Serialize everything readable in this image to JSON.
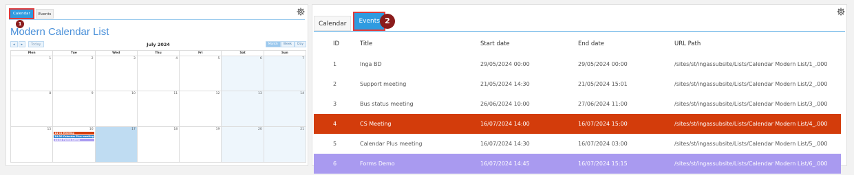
{
  "left": {
    "tabs": [
      {
        "label": "Calendar",
        "active": true
      },
      {
        "label": "Events",
        "active": false
      }
    ],
    "callout": "1",
    "title": "Modern Calendar List",
    "nav": {
      "prev": "◂",
      "next": "▸",
      "today": "Today"
    },
    "month_label": "July 2024",
    "views": [
      {
        "label": "Month",
        "active": true
      },
      {
        "label": "Week",
        "active": false
      },
      {
        "label": "Day",
        "active": false
      }
    ],
    "weekdays": [
      "Mon",
      "Tue",
      "Wed",
      "Thu",
      "Fri",
      "Sat",
      "Sun"
    ],
    "weeks": [
      {
        "days": [
          {
            "num": "1"
          },
          {
            "num": "2"
          },
          {
            "num": "3"
          },
          {
            "num": "4"
          },
          {
            "num": "5"
          },
          {
            "num": "6",
            "weekend": true
          },
          {
            "num": "7",
            "weekend": true
          }
        ]
      },
      {
        "days": [
          {
            "num": "8"
          },
          {
            "num": "9"
          },
          {
            "num": "10"
          },
          {
            "num": "11"
          },
          {
            "num": "12"
          },
          {
            "num": "13",
            "weekend": true
          },
          {
            "num": "14",
            "weekend": true
          }
        ]
      },
      {
        "days": [
          {
            "num": "15"
          },
          {
            "num": "16",
            "events": [
              {
                "text": "14 CS Meeting",
                "color": "#d33c0b"
              },
              {
                "text": "14:30 Calendar Plus meeting",
                "color": "#2f88d0"
              },
              {
                "text": "14:45 Forms Demo",
                "color": "#a99af0"
              }
            ]
          },
          {
            "num": "17",
            "today": true
          },
          {
            "num": "18"
          },
          {
            "num": "19"
          },
          {
            "num": "20",
            "weekend": true
          },
          {
            "num": "21",
            "weekend": true
          }
        ]
      }
    ]
  },
  "right": {
    "tabs": [
      {
        "label": "Calendar",
        "active": false
      },
      {
        "label": "Events",
        "active": true
      }
    ],
    "callout": "2",
    "columns": [
      "ID",
      "Title",
      "Start date",
      "End date",
      "URL Path"
    ],
    "rows": [
      {
        "id": "1",
        "title": "Inga BD",
        "start": "29/05/2024 00:00",
        "end": "29/05/2024 00:00",
        "url": "/sites/st/ingassubsite/Lists/Calendar Modern List/1_.000",
        "bg": ""
      },
      {
        "id": "2",
        "title": "Support meeting",
        "start": "21/05/2024 14:30",
        "end": "21/05/2024 15:01",
        "url": "/sites/st/ingassubsite/Lists/Calendar Modern List/2_.000",
        "bg": ""
      },
      {
        "id": "3",
        "title": "Bus status meeting",
        "start": "26/06/2024 10:00",
        "end": "27/06/2024 11:00",
        "url": "/sites/st/ingassubsite/Lists/Calendar Modern List/3_.000",
        "bg": ""
      },
      {
        "id": "4",
        "title": "CS Meeting",
        "start": "16/07/2024 14:00",
        "end": "16/07/2024 15:00",
        "url": "/sites/st/ingassubsite/Lists/Calendar Modern List/4_.000",
        "bg": "#d33c0b"
      },
      {
        "id": "5",
        "title": "Calendar Plus meeting",
        "start": "16/07/2024 14:30",
        "end": "16/07/2024 03:00",
        "url": "/sites/st/ingassubsite/Lists/Calendar Modern List/5_.000",
        "bg": ""
      },
      {
        "id": "6",
        "title": "Forms Demo",
        "start": "16/07/2024 14:45",
        "end": "16/07/2024 15:15",
        "url": "/sites/st/ingassubsite/Lists/Calendar Modern List/6_.000",
        "bg": "#a99af0"
      }
    ]
  },
  "icons": {
    "settings": "gear-icon"
  },
  "colors": {
    "accent": "#2f9be0",
    "callout": "#8b1c1c",
    "highlight_border": "#e03a3a"
  }
}
